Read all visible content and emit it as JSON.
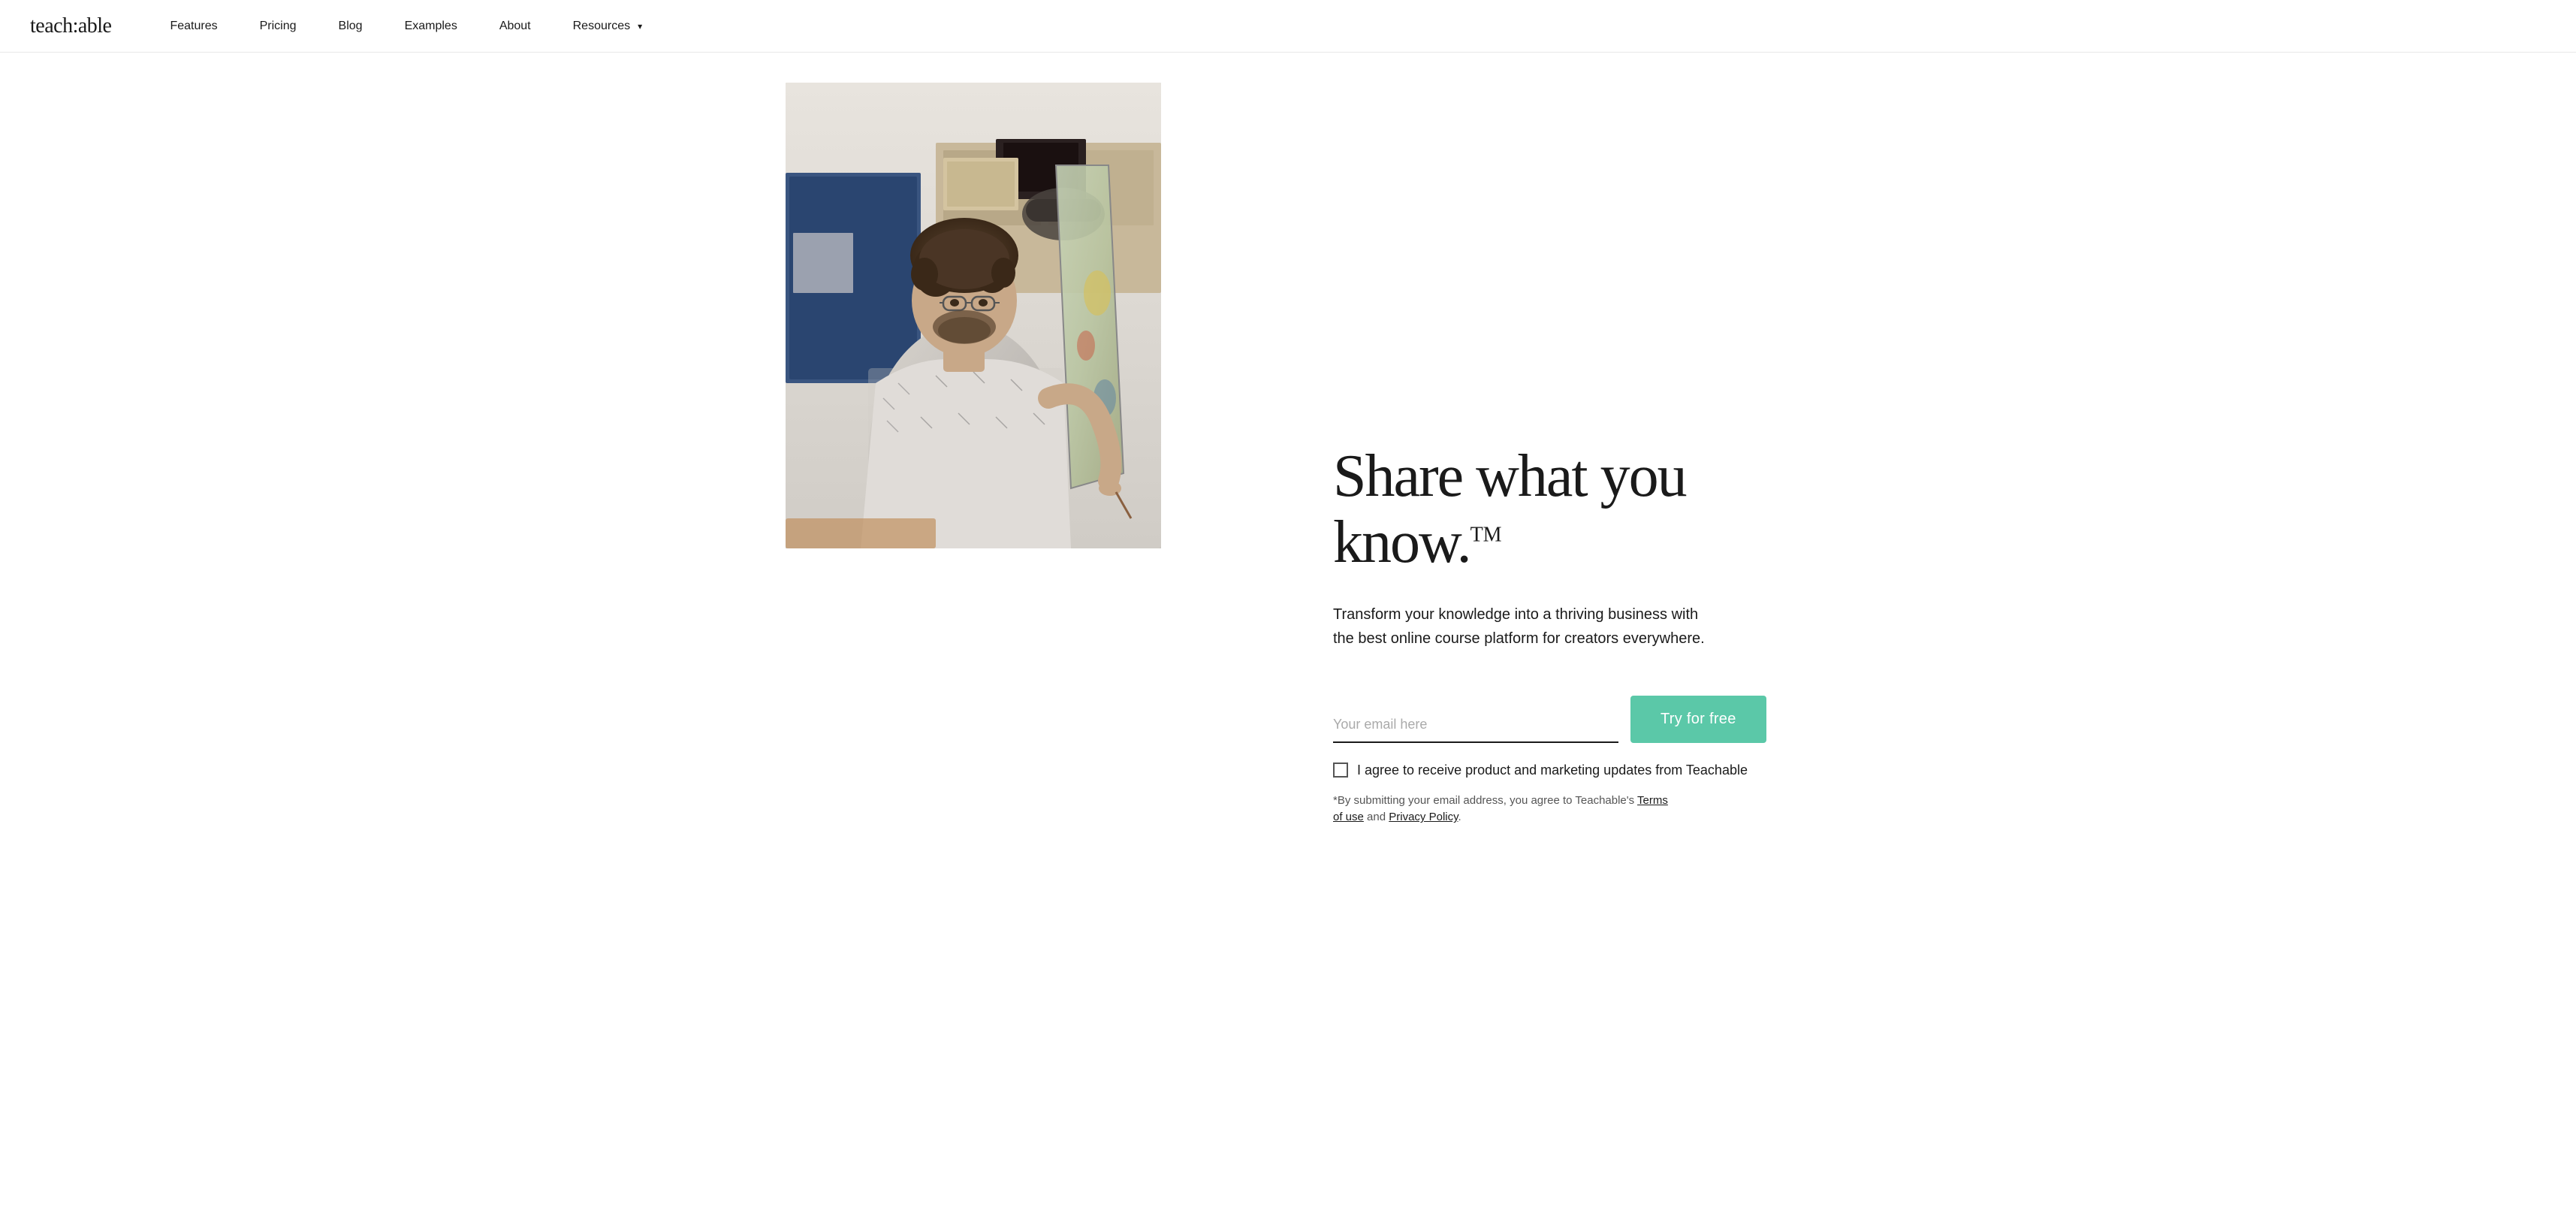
{
  "logo": {
    "text": "teach:able"
  },
  "nav": {
    "items": [
      {
        "label": "Features",
        "hasDropdown": false
      },
      {
        "label": "Pricing",
        "hasDropdown": false
      },
      {
        "label": "Blog",
        "hasDropdown": false
      },
      {
        "label": "Examples",
        "hasDropdown": false
      },
      {
        "label": "About",
        "hasDropdown": false
      },
      {
        "label": "Resources",
        "hasDropdown": true
      }
    ]
  },
  "hero": {
    "title_line1": "Share what you",
    "title_line2": "know.",
    "title_tm": "TM",
    "subtitle": "Transform your knowledge into a thriving business with the best online course platform for creators everywhere.",
    "email_placeholder": "Your email here",
    "cta_button": "Try for free",
    "checkbox_label": "I agree to receive product and marketing updates from Teachable",
    "fine_print_before": "*By submitting your email address, you agree to Teachable's ",
    "fine_print_terms": "Terms of use",
    "fine_print_mid": " and ",
    "fine_print_privacy": "Privacy Policy",
    "fine_print_end": "."
  }
}
